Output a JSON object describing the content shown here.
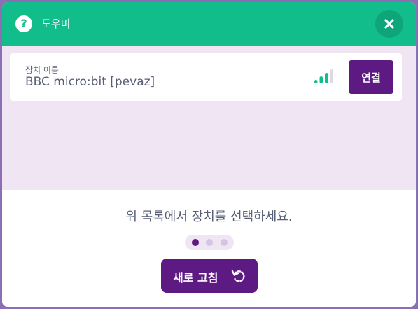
{
  "header": {
    "help_icon": "question-circle-icon",
    "help_glyph": "?",
    "title": "도우미",
    "close_icon": "close-icon"
  },
  "colors": {
    "header_bg": "#12bd8c",
    "accent": "#5d1a83",
    "list_bg": "#efe5f3",
    "text": "#575e75"
  },
  "device": {
    "label": "장치 이름",
    "name": "BBC micro:bit [pevaz]",
    "signal_icon": "signal-strength-icon",
    "signal_bars_filled": 3,
    "signal_bars_total": 4,
    "connect_label": "연결"
  },
  "footer": {
    "instruction": "위 목록에서 장치를 선택하세요.",
    "step_count": 3,
    "active_step": 1,
    "refresh_label": "새로 고침",
    "refresh_icon": "refresh-icon"
  }
}
